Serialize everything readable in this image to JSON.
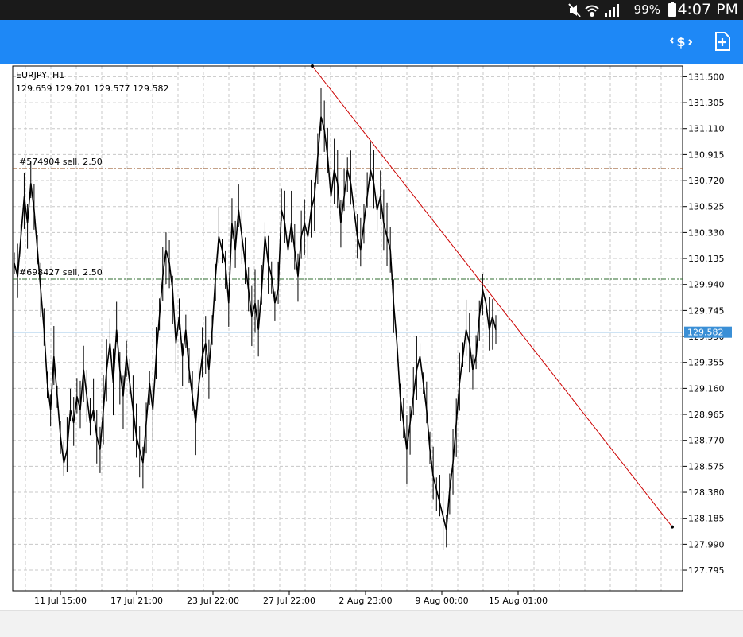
{
  "status_bar": {
    "battery_pct": "99%",
    "time": "4:07 PM"
  },
  "app_bar": {
    "icons": [
      "trade-money-icon",
      "new-document-icon"
    ]
  },
  "chart_data": {
    "type": "candlestick-line",
    "symbol_label": "EURJPY, H1",
    "ohlc_label": "129.659 129.701 129.577 129.582",
    "current_price": "129.582",
    "ylim": [
      127.64,
      131.58
    ],
    "yticks": [
      "131.500",
      "131.305",
      "131.110",
      "130.915",
      "130.720",
      "130.525",
      "130.330",
      "130.135",
      "129.940",
      "129.745",
      "129.550",
      "129.355",
      "129.160",
      "128.965",
      "128.770",
      "128.575",
      "128.380",
      "128.185",
      "127.990",
      "127.795"
    ],
    "xticks": [
      "11 Jul 15:00",
      "17 Jul 21:00",
      "23 Jul 22:00",
      "27 Jul 22:00",
      "2 Aug 23:00",
      "9 Aug 00:00",
      "15 Aug 01:00"
    ],
    "grid": true,
    "orders": [
      {
        "label": "#574904 sell, 2.50",
        "price": 130.81,
        "color": "#8b4513"
      },
      {
        "label": "#698427 sell, 2.50",
        "price": 129.98,
        "color": "#2e6b2e"
      }
    ],
    "trendline": {
      "from_price": 131.58,
      "to_price": 128.12,
      "color": "#cc0000"
    },
    "series": [
      {
        "values": [
          130.1,
          130.0,
          130.3,
          130.6,
          130.4,
          130.7,
          130.5,
          130.2,
          129.9,
          129.6,
          129.2,
          129.0,
          129.4,
          129.1,
          128.8,
          128.6,
          128.7,
          129.0,
          128.9,
          129.1,
          129.0,
          129.3,
          129.1,
          128.9,
          129.0,
          128.8,
          128.7,
          129.0,
          129.3,
          129.5,
          129.2,
          129.6,
          129.3,
          129.1,
          129.4,
          129.2,
          129.0,
          128.8,
          128.7,
          128.6,
          128.9,
          129.2,
          129.0,
          129.4,
          129.7,
          130.0,
          130.2,
          130.1,
          129.9,
          129.5,
          129.7,
          129.4,
          129.6,
          129.3,
          129.1,
          128.9,
          129.2,
          129.4,
          129.5,
          129.3,
          129.6,
          130.0,
          130.3,
          130.2,
          130.1,
          129.8,
          130.4,
          130.2,
          130.5,
          130.3,
          130.1,
          129.9,
          129.7,
          129.8,
          129.6,
          129.9,
          130.3,
          130.1,
          130.0,
          129.8,
          129.9,
          130.5,
          130.4,
          130.2,
          130.4,
          130.2,
          130.0,
          130.3,
          130.4,
          130.3,
          130.5,
          130.6,
          130.9,
          131.2,
          131.1,
          130.9,
          130.6,
          130.8,
          130.7,
          130.4,
          130.6,
          130.8,
          130.7,
          130.5,
          130.3,
          130.2,
          130.4,
          130.6,
          130.8,
          130.7,
          130.5,
          130.6,
          130.4,
          130.3,
          130.2,
          129.8,
          129.5,
          129.1,
          128.9,
          128.7,
          128.9,
          129.1,
          129.3,
          129.4,
          129.2,
          129.0,
          128.7,
          128.5,
          128.4,
          128.3,
          128.2,
          128.1,
          128.4,
          128.6,
          128.9,
          129.2,
          129.4,
          129.6,
          129.5,
          129.3,
          129.4,
          129.7,
          129.9,
          129.8,
          129.6,
          129.7,
          129.6
        ]
      }
    ]
  }
}
